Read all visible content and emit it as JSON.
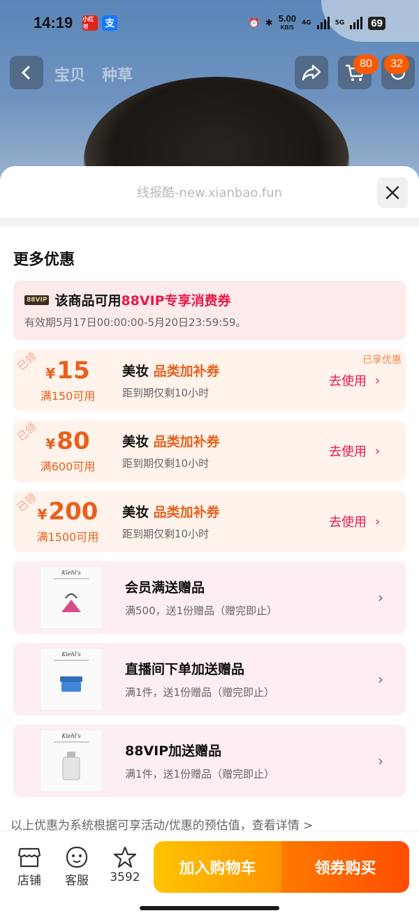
{
  "status_bar": {
    "time": "14:19",
    "app_icon_1": "小红书",
    "app_icon_2": "支",
    "speed": "5.00",
    "speed_unit": "KB/S",
    "net1": "4G",
    "net2": "5G",
    "battery": "69"
  },
  "nav": {
    "tabs": [
      "宝贝",
      "种草"
    ],
    "cart_badge": "80",
    "more_badge": "32"
  },
  "sheet": {
    "watermark": "线报酷-new.xianbao.fun",
    "section_title": "更多优惠",
    "vip": {
      "tag": "88VIP",
      "prefix": "该商品可用",
      "highlight": "88VIP专享消费券",
      "validity": "有效期5月17日00:00:00-5月20日23:59:59。"
    },
    "coupons": [
      {
        "stamp": "已领",
        "currency": "¥",
        "amount": "15",
        "condition": "满150可用",
        "title_prefix": "美妆 ",
        "title_highlight": "品类加补券",
        "subtitle": "距到期仅剩10小时",
        "action": "去使用",
        "badge": "已享优惠"
      },
      {
        "stamp": "已领",
        "currency": "¥",
        "amount": "80",
        "condition": "满600可用",
        "title_prefix": "美妆 ",
        "title_highlight": "品类加补券",
        "subtitle": "距到期仅剩10小时",
        "action": "去使用"
      },
      {
        "stamp": "已领",
        "currency": "¥",
        "amount": "200",
        "condition": "满1500可用",
        "title_prefix": "美妆 ",
        "title_highlight": "品类加补券",
        "subtitle": "距到期仅剩10小时",
        "action": "去使用"
      }
    ],
    "gifts": [
      {
        "brand": "Kiehl's",
        "title": "会员满送赠品",
        "subtitle": "满500，送1份赠品（赠完即止）"
      },
      {
        "brand": "Kiehl's",
        "title": "直播间下单加送赠品",
        "subtitle": "满1件，送1份赠品（赠完即止）"
      },
      {
        "brand": "Kiehl's",
        "title": "88VIP加送赠品",
        "subtitle": "满1件，送1份赠品（赠完即止）"
      }
    ],
    "footnote": "以上优惠为系统根据可享活动/优惠的预估值，查看详情 >"
  },
  "bottom_bar": {
    "shop_label": "店铺",
    "service_label": "客服",
    "fav_count": "3592",
    "add_to_cart": "加入购物车",
    "buy": "领券购买"
  }
}
